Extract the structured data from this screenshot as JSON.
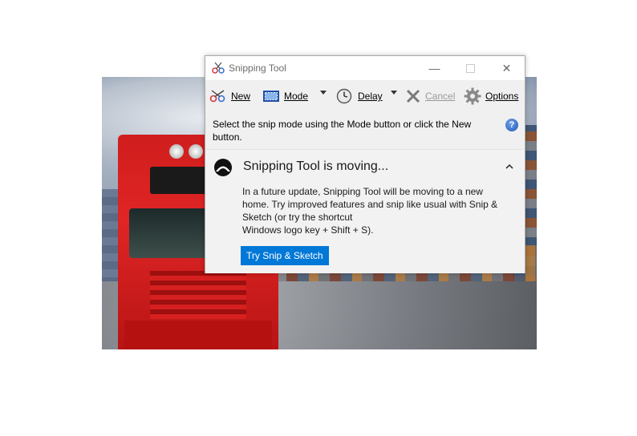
{
  "window": {
    "title": "Snipping Tool",
    "controls": {
      "minimize": "—",
      "close": "✕"
    }
  },
  "toolbar": {
    "new_label": "New",
    "mode_label": "Mode",
    "delay_label": "Delay",
    "cancel_label": "Cancel",
    "options_label": "Options"
  },
  "hint": {
    "text": "Select the snip mode using the Mode button or click the New button.",
    "help_glyph": "?"
  },
  "notice": {
    "heading": "Snipping Tool is moving...",
    "body_line1": "In a future update, Snipping Tool will be moving to a new home. Try improved features and snip like usual with Snip & Sketch (or try the shortcut",
    "body_line2": "Windows logo key + Shift + S).",
    "cta_label": "Try Snip & Sketch"
  },
  "colors": {
    "accent": "#0078d7",
    "window_bg": "#f0f0f0",
    "titlebar_bg": "#ffffff"
  },
  "icons": {
    "app": "scissors-icon",
    "new": "scissors-icon",
    "mode": "rectangle-snip-icon",
    "delay": "clock-icon",
    "cancel": "x-icon",
    "options": "gear-icon",
    "help": "help-icon",
    "notice": "snip-sketch-logo-icon",
    "collapse": "chevron-up-icon"
  }
}
